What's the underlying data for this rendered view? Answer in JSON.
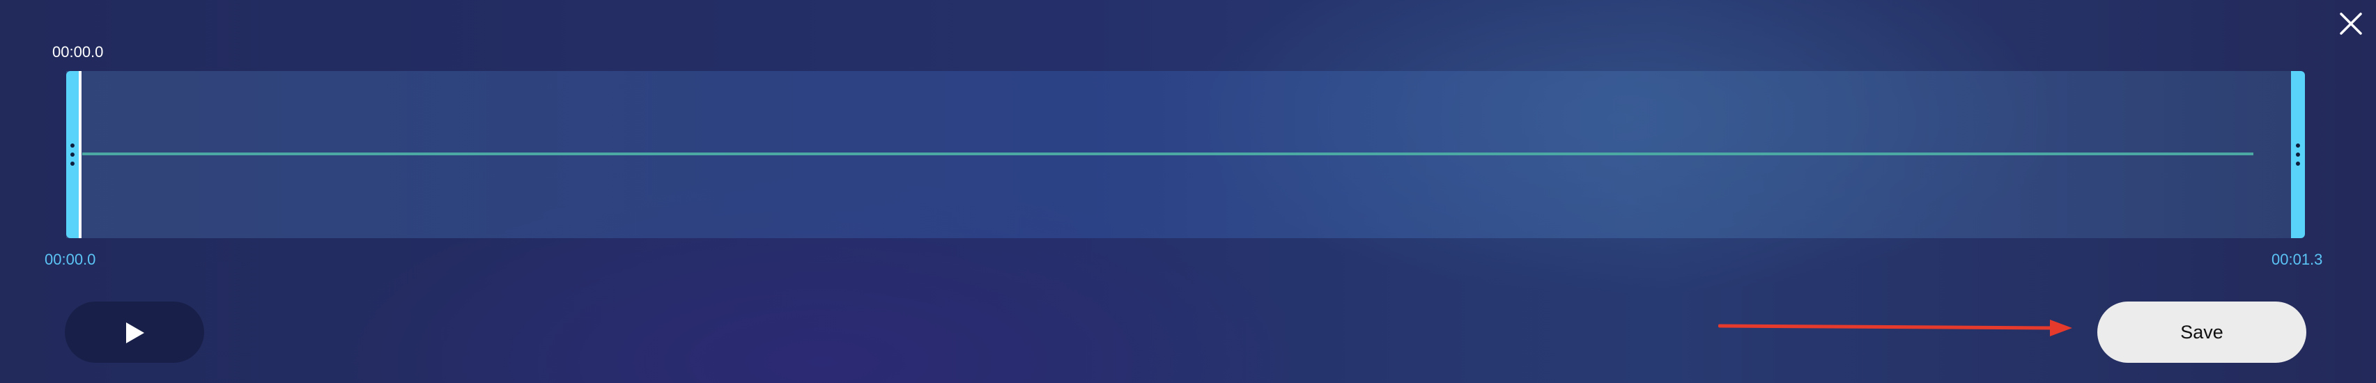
{
  "header": {
    "current_time": "00:00.0"
  },
  "timeline": {
    "start_time": "00:00.0",
    "end_time": "00:01.3"
  },
  "controls": {
    "play_icon": "play-icon",
    "save_label": "Save",
    "close_icon": "close-icon"
  },
  "colors": {
    "handle": "#5ad3fb",
    "time_label": "#5bc4f5",
    "waveform": "#4ba8a2",
    "annotation_arrow": "#e53a2c",
    "save_button_bg": "#ececec",
    "play_button_bg": "#18204a"
  }
}
